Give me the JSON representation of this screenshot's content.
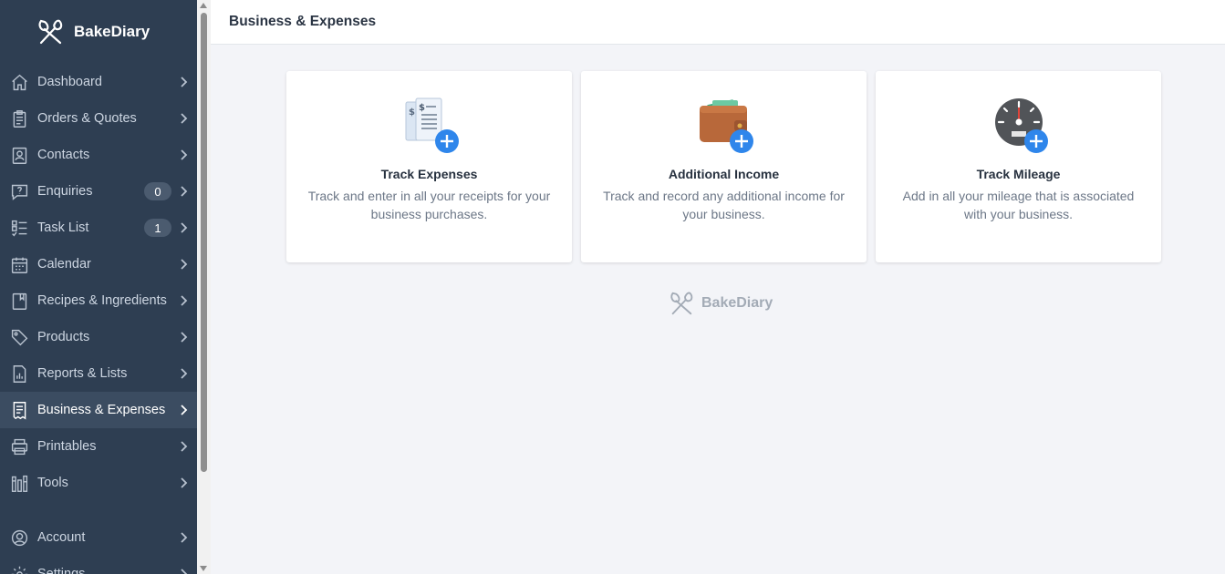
{
  "brand": {
    "name": "BakeDiary",
    "footer_name": "BakeDiary"
  },
  "header": {
    "title": "Business & Expenses"
  },
  "sidebar": {
    "items": [
      {
        "label": "Dashboard",
        "icon": "home-icon"
      },
      {
        "label": "Orders & Quotes",
        "icon": "clipboard-icon"
      },
      {
        "label": "Contacts",
        "icon": "contact-card-icon"
      },
      {
        "label": "Enquiries",
        "icon": "question-bubble-icon",
        "badge": "0"
      },
      {
        "label": "Task List",
        "icon": "checklist-icon",
        "badge": "1"
      },
      {
        "label": "Calendar",
        "icon": "calendar-icon"
      },
      {
        "label": "Recipes & Ingredients",
        "icon": "book-icon"
      },
      {
        "label": "Products",
        "icon": "tag-icon"
      },
      {
        "label": "Reports & Lists",
        "icon": "report-icon"
      },
      {
        "label": "Business & Expenses",
        "icon": "receipt-icon",
        "active": true
      },
      {
        "label": "Printables",
        "icon": "printer-icon"
      },
      {
        "label": "Tools",
        "icon": "tools-icon"
      }
    ],
    "bottom_items": [
      {
        "label": "Account",
        "icon": "account-icon"
      },
      {
        "label": "Settings",
        "icon": "gear-icon"
      }
    ]
  },
  "cards": [
    {
      "title": "Track Expenses",
      "description": "Track and enter in all your receipts for your business purchases.",
      "icon": "receipts-plus-icon"
    },
    {
      "title": "Additional Income",
      "description": "Track and record any additional income for your business.",
      "icon": "wallet-plus-icon"
    },
    {
      "title": "Track Mileage",
      "description": "Add in all your mileage that is associated with your business.",
      "icon": "speedometer-plus-icon"
    }
  ],
  "colors": {
    "sidebar_bg": "#2e3e52",
    "active_bg": "#3b4c61",
    "accent": "#2f86eb",
    "page_bg": "#f3f4f8"
  }
}
